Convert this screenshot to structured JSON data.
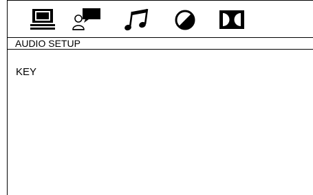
{
  "tabs": [
    {
      "icon": "monitor-icon",
      "label": ""
    },
    {
      "icon": "speech-person-icon",
      "label": ""
    },
    {
      "icon": "music-note-icon",
      "label": ""
    },
    {
      "icon": "contrast-circle-icon",
      "label": ""
    },
    {
      "icon": "dolby-icon",
      "label": ""
    }
  ],
  "header": {
    "title": "AUDIO SETUP"
  },
  "menu": {
    "items": [
      "KEY"
    ]
  }
}
